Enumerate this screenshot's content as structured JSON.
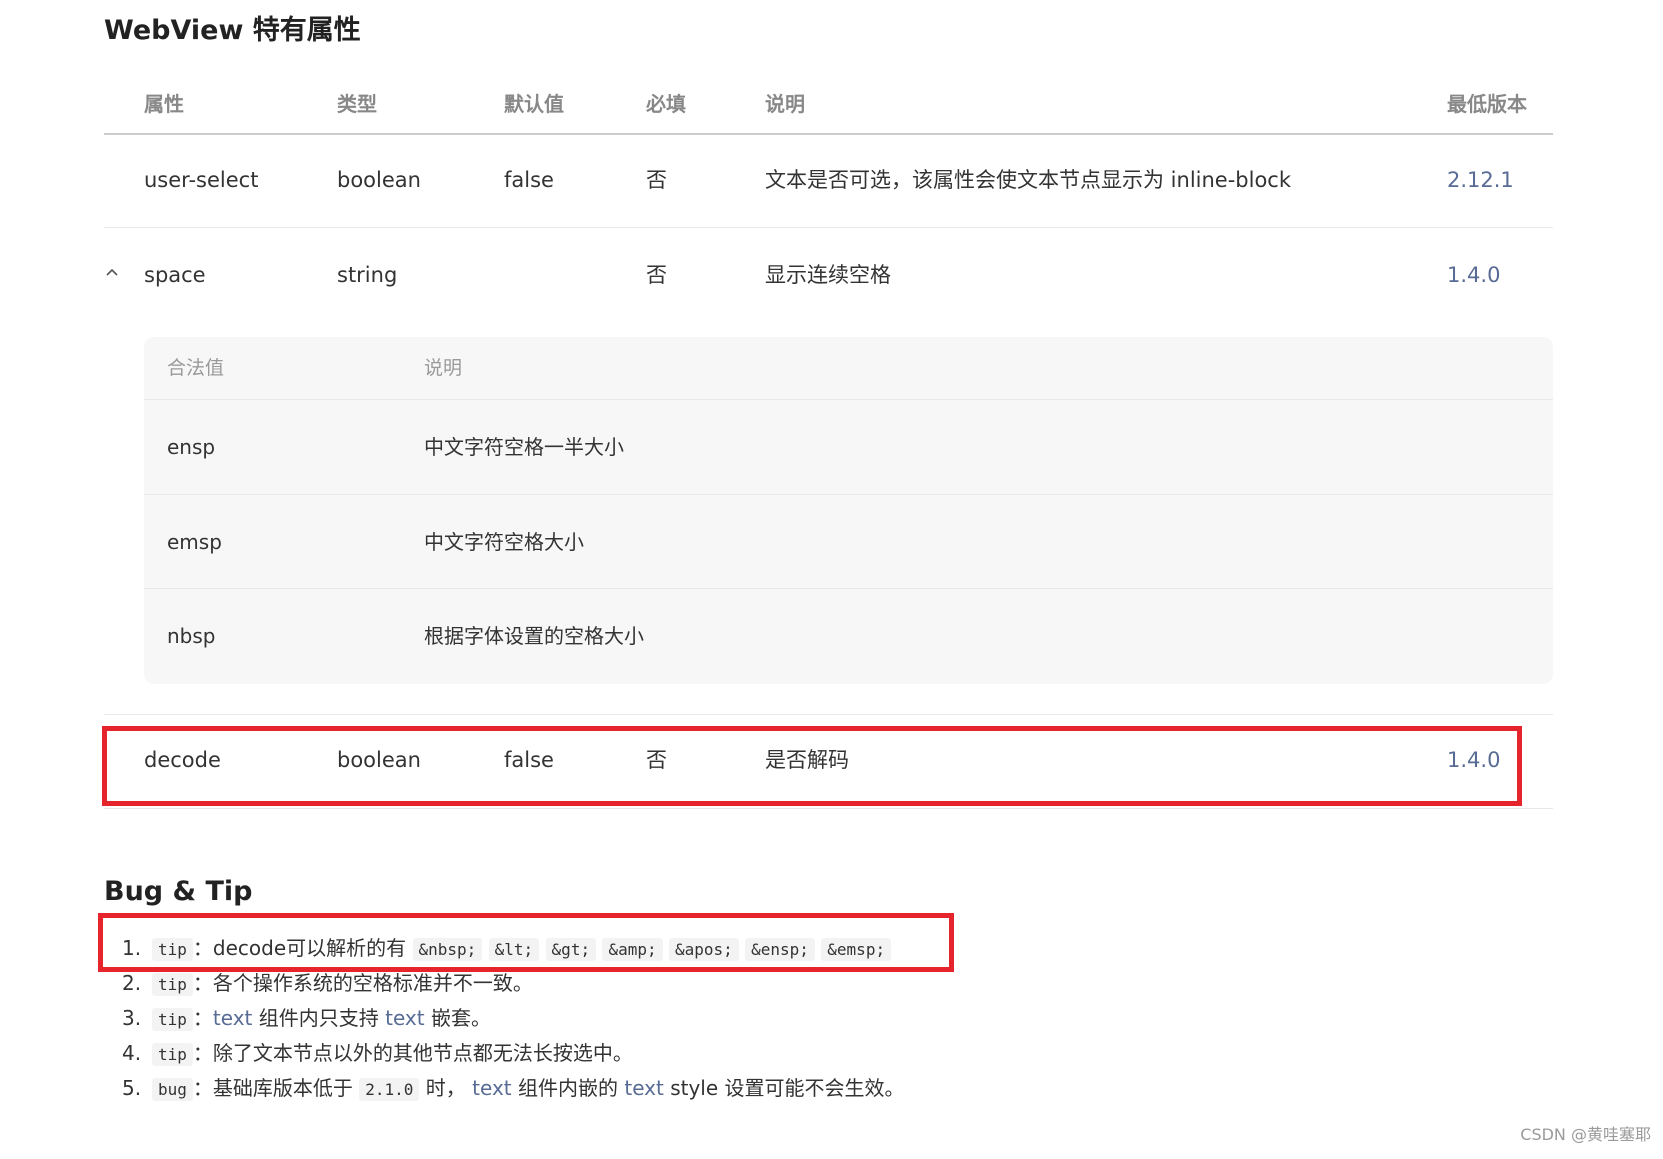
{
  "section_title": "WebView 特有属性",
  "table": {
    "headers": [
      "属性",
      "类型",
      "默认值",
      "必填",
      "说明",
      "最低版本"
    ],
    "rows": [
      {
        "name": "user-select",
        "type": "boolean",
        "default": "false",
        "required": "否",
        "desc": "文本是否可选，该属性会使文本节点显示为 inline-block",
        "version": "2.12.1"
      },
      {
        "name": "space",
        "type": "string",
        "default": "",
        "required": "否",
        "desc": "显示连续空格",
        "version": "1.4.0"
      },
      {
        "name": "decode",
        "type": "boolean",
        "default": "false",
        "required": "否",
        "desc": "是否解码",
        "version": "1.4.0"
      }
    ],
    "space_values": {
      "headers": [
        "合法值",
        "说明"
      ],
      "rows": [
        {
          "value": "ensp",
          "desc": "中文字符空格一半大小"
        },
        {
          "value": "emsp",
          "desc": "中文字符空格大小"
        },
        {
          "value": "nbsp",
          "desc": "根据字体设置的空格大小"
        }
      ]
    }
  },
  "bug_tip": {
    "title": "Bug & Tip",
    "items": [
      {
        "num": "1.",
        "tag": "tip",
        "sep": "：",
        "text1": "decode可以解析的有",
        "codes": [
          "&nbsp;",
          "&lt;",
          "&gt;",
          "&amp;",
          "&apos;",
          "&ensp;",
          "&emsp;"
        ]
      },
      {
        "num": "2.",
        "tag": "tip",
        "sep": "：",
        "text1": "各个操作系统的空格标准并不一致。"
      },
      {
        "num": "3.",
        "tag": "tip",
        "sep": "：",
        "link1": "text",
        "text1": " 组件内只支持 ",
        "link2": "text",
        "text2": " 嵌套。"
      },
      {
        "num": "4.",
        "tag": "tip",
        "sep": "：",
        "text1": "除了文本节点以外的其他节点都无法长按选中。"
      },
      {
        "num": "5.",
        "tag": "bug",
        "sep": "：",
        "text1": "基础库版本低于 ",
        "code": "2.1.0",
        "text2": " 时， ",
        "link1": "text",
        "text3": " 组件内嵌的 ",
        "link2": "text",
        "text4": " style 设置可能不会生效。"
      }
    ]
  },
  "watermark": "CSDN @黄哇塞耶",
  "colors": {
    "highlight": "#e5242b",
    "link": "#576b95",
    "subtable_bg": "#f7f7f7"
  }
}
